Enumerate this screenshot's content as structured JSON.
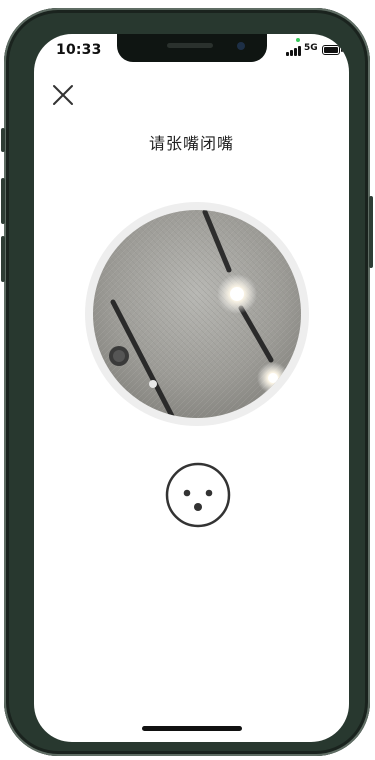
{
  "status_bar": {
    "time": "10:33",
    "network": "5G",
    "icons": [
      "signal-icon",
      "battery-icon"
    ]
  },
  "header": {
    "close_icon": "close-icon",
    "title": "请张嘴闭嘴"
  },
  "camera": {
    "content": "camera-preview",
    "ring_color": "#eeeeee"
  },
  "prompt_icon": "mouth-open-face-icon",
  "colors": {
    "frame": "#28382f",
    "text": "#222222",
    "icon": "#333333"
  }
}
